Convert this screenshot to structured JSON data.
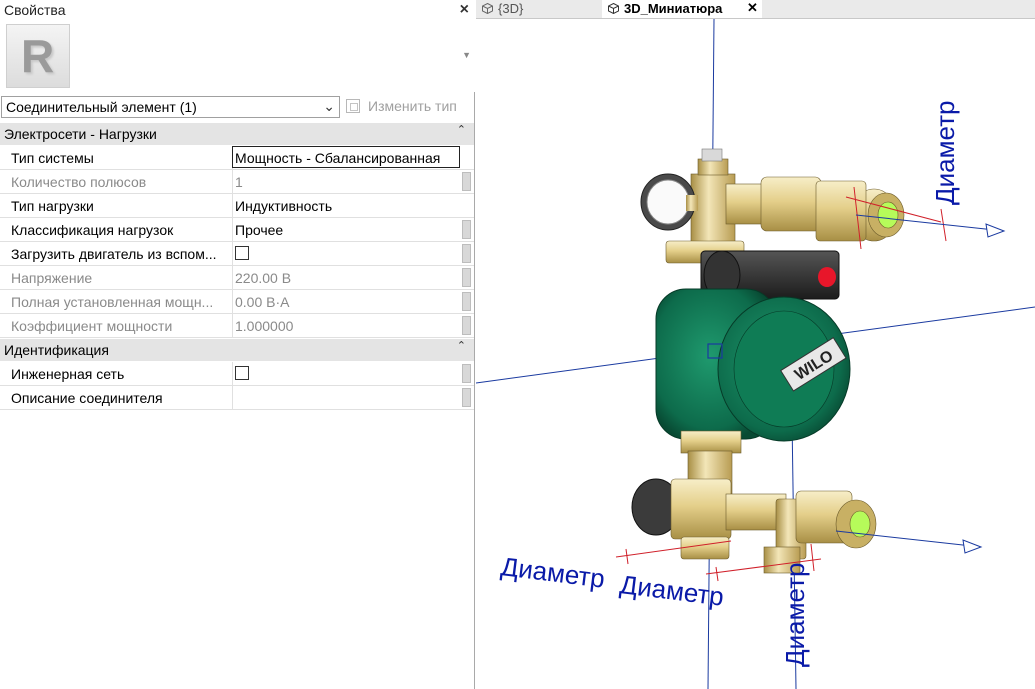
{
  "properties": {
    "title": "Свойства",
    "type_selector": "Соединительный элемент (1)",
    "edit_type_label": "Изменить тип",
    "groups": [
      {
        "label": "Электросети - Нагрузки",
        "rows": [
          {
            "name": "Тип системы",
            "value": "Мощность - Сбалансированная",
            "editing": true
          },
          {
            "name": "Количество полюсов",
            "value": "1",
            "disabled": true
          },
          {
            "name": "Тип нагрузки",
            "value": "Индуктивность"
          },
          {
            "name": "Классификация нагрузок",
            "value": "Прочее"
          },
          {
            "name": "Загрузить двигатель из вспом...",
            "checkbox": true
          },
          {
            "name": "Напряжение",
            "value": "220.00 В",
            "disabled": true
          },
          {
            "name": "Полная установленная мощн...",
            "value": "0.00 В·А",
            "disabled": true
          },
          {
            "name": "Коэффициент мощности",
            "value": "1.000000",
            "disabled": true
          }
        ]
      },
      {
        "label": "Идентификация",
        "rows": [
          {
            "name": "Инженерная сеть",
            "checkbox": true
          },
          {
            "name": "Описание соединителя",
            "value": ""
          }
        ]
      }
    ]
  },
  "tabs": [
    {
      "label": "{3D}",
      "active": false
    },
    {
      "label": "3D_Миниатюра",
      "active": true
    }
  ],
  "viewport": {
    "pump_brand": "WILO",
    "dimension_labels": [
      "Диаметр",
      "Диаметр",
      "Диаметр",
      "Диаметр"
    ]
  }
}
